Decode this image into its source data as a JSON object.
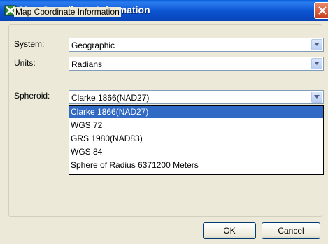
{
  "window": {
    "title": "Map Coordinate Information"
  },
  "group": {
    "legend": "Map Coordinate Information"
  },
  "fields": {
    "system": {
      "label": "System:",
      "value": "Geographic"
    },
    "units": {
      "label": "Units:",
      "value": "Radians"
    },
    "spheroid": {
      "label": "Spheroid:",
      "value": "Clarke 1866(NAD27)"
    }
  },
  "dropdown": {
    "selected_index": 0,
    "options": [
      "Clarke 1866(NAD27)",
      "WGS 72",
      "GRS 1980(NAD83)",
      "WGS 84",
      "Sphere of Radius 6371200 Meters"
    ]
  },
  "buttons": {
    "ok": "OK",
    "cancel": "Cancel"
  },
  "colors": {
    "title_bar": "#0a53d0",
    "selection": "#316ac5",
    "dialog_bg": "#ece9d8"
  }
}
